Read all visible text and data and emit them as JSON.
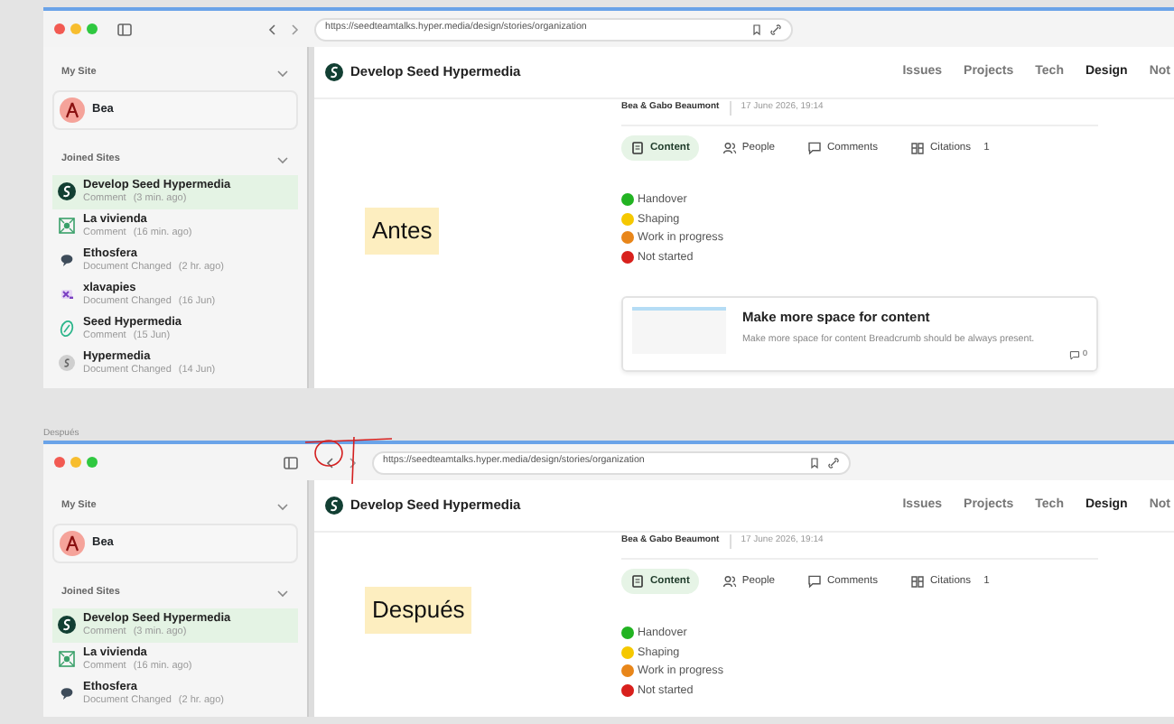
{
  "panels": [
    {
      "kind": "inline",
      "url": "https://seedteamtalks.hyper.media/design/stories/organization",
      "sidebar": {
        "my_site_title": "My Site",
        "user": "Bea",
        "joined_title": "Joined Sites",
        "sites": [
          {
            "name": "Develop Seed Hypermedia",
            "event": "Comment",
            "time": "(3 min. ago)",
            "selected": true,
            "kind": "seed"
          },
          {
            "name": "La vivienda",
            "event": "Comment",
            "time": "(16 min. ago)",
            "selected": false,
            "kind": "grid"
          },
          {
            "name": "Ethosfera",
            "event": "Document Changed",
            "time": "(2 hr. ago)",
            "selected": false,
            "kind": "bubble"
          },
          {
            "name": "xlavapies",
            "event": "Document Changed",
            "time": "(16 Jun)",
            "selected": false,
            "kind": "letter"
          },
          {
            "name": "Seed Hypermedia",
            "event": "Comment",
            "time": "(15 Jun)",
            "selected": false,
            "kind": "leaf"
          },
          {
            "name": "Hypermedia",
            "event": "Document Changed",
            "time": "(14 Jun)",
            "selected": false,
            "kind": "coin"
          }
        ]
      },
      "site_title": "Develop Seed Hypermedia",
      "nav": [
        {
          "label": "Issues",
          "selected": false
        },
        {
          "label": "Projects",
          "selected": false
        },
        {
          "label": "Tech",
          "selected": false
        },
        {
          "label": "Design",
          "selected": true
        },
        {
          "label": "Not",
          "selected": false
        }
      ],
      "author": "Bea & Gabo Beaumont",
      "date": "17 June 2026, 19:14",
      "tabs": [
        {
          "label": "Content",
          "kind": "content",
          "selected": true
        },
        {
          "label": "People",
          "kind": "people",
          "selected": false
        },
        {
          "label": "Comments",
          "kind": "comments",
          "selected": false
        },
        {
          "label": "Citations",
          "kind": "citations",
          "count": "1",
          "selected": false
        }
      ],
      "statuses": [
        {
          "label": "Handover",
          "color": "#22b322"
        },
        {
          "label": "Shaping",
          "color": "#f5c800"
        },
        {
          "label": "Work in progress",
          "color": "#e8861a"
        },
        {
          "label": "Not started",
          "color": "#d8201c"
        }
      ],
      "note": "Antes",
      "card": {
        "title": "Make more space for content",
        "description": "Make more space for content Breadcrumb should be always present.",
        "comments": "0"
      }
    },
    {
      "caption": "Después",
      "kind": "docked",
      "annotation": {
        "kind": "circle"
      },
      "url": "https://seedteamtalks.hyper.media/design/stories/organization",
      "sidebar": {
        "my_site_title": "My Site",
        "user": "Bea",
        "joined_title": "Joined Sites",
        "sites": [
          {
            "name": "Develop Seed Hypermedia",
            "event": "Comment",
            "time": "(3 min. ago)",
            "selected": true,
            "kind": "seed"
          },
          {
            "name": "La vivienda",
            "event": "Comment",
            "time": "(16 min. ago)",
            "selected": false,
            "kind": "grid"
          },
          {
            "name": "Ethosfera",
            "event": "Document Changed",
            "time": "(2 hr. ago)",
            "selected": false,
            "kind": "bubble"
          }
        ]
      },
      "site_title": "Develop Seed Hypermedia",
      "nav": [
        {
          "label": "Issues",
          "selected": false
        },
        {
          "label": "Projects",
          "selected": false
        },
        {
          "label": "Tech",
          "selected": false
        },
        {
          "label": "Design",
          "selected": true
        },
        {
          "label": "Not",
          "selected": false
        }
      ],
      "author": "Bea & Gabo Beaumont",
      "date": "17 June 2026, 19:14",
      "tabs": [
        {
          "label": "Content",
          "kind": "content",
          "selected": true
        },
        {
          "label": "People",
          "kind": "people",
          "selected": false
        },
        {
          "label": "Comments",
          "kind": "comments",
          "selected": false
        },
        {
          "label": "Citations",
          "kind": "citations",
          "count": "1",
          "selected": false
        }
      ],
      "statuses": [
        {
          "label": "Handover",
          "color": "#22b322"
        },
        {
          "label": "Shaping",
          "color": "#f5c800"
        },
        {
          "label": "Work in progress",
          "color": "#e8861a"
        },
        {
          "label": "Not started",
          "color": "#d8201c"
        }
      ],
      "note": "Después"
    }
  ]
}
